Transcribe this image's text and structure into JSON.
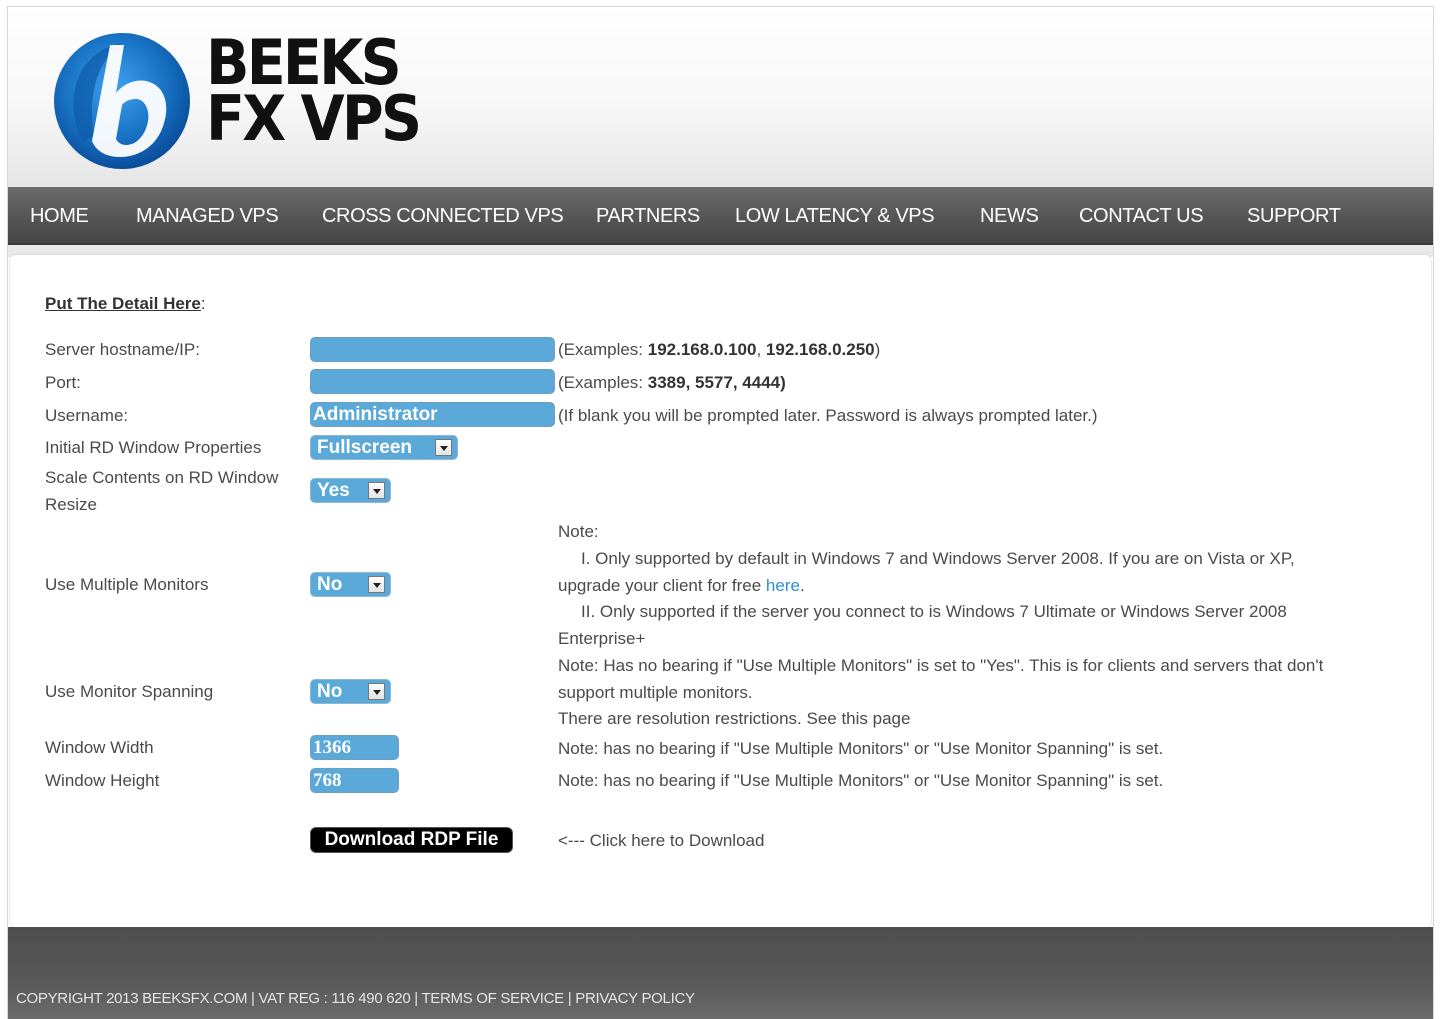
{
  "brand": {
    "logo_line1": "BEEKS",
    "logo_line2": "FX VPS",
    "logo_colors": {
      "outer": "#1a74c6",
      "inner": "#0a4e9c",
      "letter": "#ffffff"
    }
  },
  "nav": {
    "items": [
      {
        "label": "HOME"
      },
      {
        "label": "MANAGED VPS"
      },
      {
        "label": "CROSS CONNECTED VPS"
      },
      {
        "label": "PARTNERS"
      },
      {
        "label": "LOW LATENCY & VPS"
      },
      {
        "label": "NEWS"
      },
      {
        "label": "CONTACT US"
      },
      {
        "label": "SUPPORT"
      }
    ]
  },
  "form": {
    "section_title": "Put The Detail Here",
    "section_colon": ":",
    "hostname": {
      "label": "Server hostname/IP:",
      "value": "",
      "note_prefix": "(Examples: ",
      "note_values": "192.168.0.100",
      "note_sep": ", ",
      "note_values2": "192.168.0.250",
      "note_suffix": ")"
    },
    "port": {
      "label": "Port:",
      "value": "",
      "note_prefix": "(Examples: ",
      "note_values": "3389, 5577, 4444)"
    },
    "username": {
      "label": "Username:",
      "value": "Administrator",
      "note": "(If blank you will be prompted later. Password is always prompted later.)"
    },
    "window_properties": {
      "label": "Initial RD Window Properties",
      "selected": "Fullscreen"
    },
    "scale_contents": {
      "label_line1": "Scale Contents on RD Window",
      "label_line2": "Resize",
      "selected": "Yes"
    },
    "multiple_monitors": {
      "label": "Use Multiple Monitors",
      "selected": "No",
      "note_title": "Note:",
      "note_i": "I. Only supported by default in Windows 7 and Windows Server 2008. If you are on Vista or XP,",
      "note_i_cont": "upgrade your client for free ",
      "note_i_link": "here",
      "note_i_end": ".",
      "note_ii": "II. Only supported if the server you connect to is Windows 7 Ultimate or Windows Server 2008",
      "note_ii_cont": "Enterprise+"
    },
    "monitor_spanning": {
      "label": "Use Monitor Spanning",
      "selected": "No",
      "note_line1": "Note: Has no bearing if \"Use Multiple Monitors\" is set to \"Yes\". This is for clients and servers that don't",
      "note_line2": "support multiple monitors.",
      "note_line3": "There are resolution restrictions. See this page"
    },
    "window_width": {
      "label": "Window Width",
      "value": "1366",
      "note": "Note: has no bearing if \"Use Multiple Monitors\" or \"Use Monitor Spanning\" is set."
    },
    "window_height": {
      "label": "Window Height",
      "value": "768",
      "note": "Note: has no bearing if \"Use Multiple Monitors\" or \"Use Monitor Spanning\" is set."
    },
    "download": {
      "button_label": "Download RDP File",
      "hint": "<--- Click here to Download"
    }
  },
  "footer": {
    "copyright": "COPYRIGHT 2013 BEEKSFX.COM",
    "sep": " | ",
    "vat": "VAT REG : 116 490 620",
    "terms": "TERMS OF SERVICE",
    "privacy": "PRIVACY POLICY"
  },
  "colors": {
    "nav_bg": "#575757",
    "field_bg": "#5aa9d9",
    "link": "#2e8fd4",
    "button_bg": "#000000"
  }
}
